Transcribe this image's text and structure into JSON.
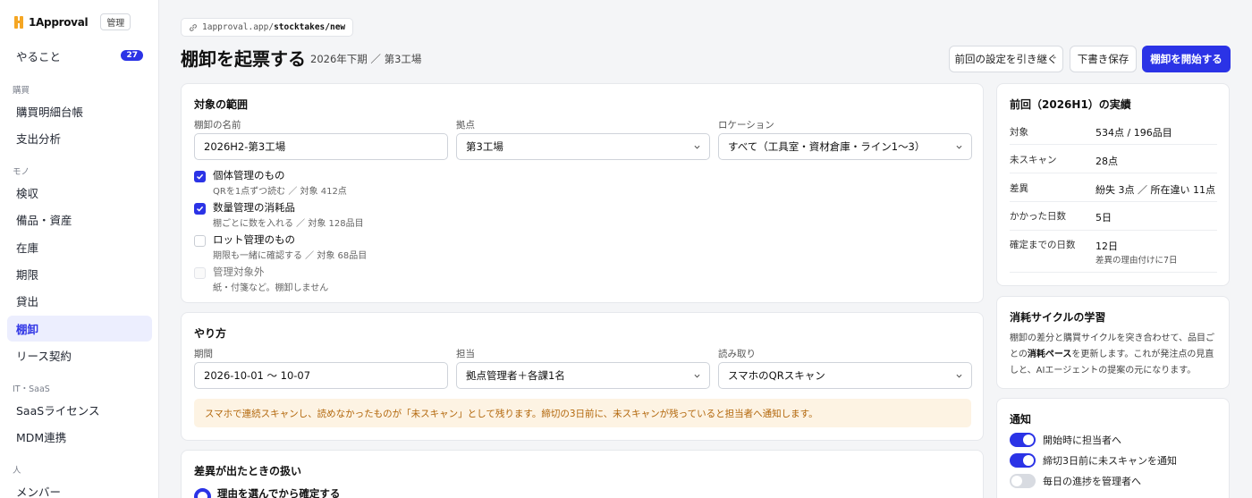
{
  "app": {
    "name": "1Approval",
    "admin_badge": "管理"
  },
  "sidebar": {
    "todo": {
      "label": "やること",
      "count": "27"
    },
    "sections": {
      "purchase": "購買",
      "mono": "モノ",
      "it_saas": "IT・SaaS",
      "people": "人"
    },
    "items": {
      "ledger": "購買明細台帳",
      "spend": "支出分析",
      "inspection": "検収",
      "assets": "備品・資産",
      "inventory": "在庫",
      "expiry": "期限",
      "lending": "貸出",
      "stocktake": "棚卸",
      "lease": "リース契約",
      "saas": "SaaSライセンス",
      "mdm": "MDM連携",
      "members": "メンバー"
    }
  },
  "url": {
    "prefix": "1approval.app/",
    "path": "stocktakes/new"
  },
  "header": {
    "title": "棚卸を起票する",
    "subtitle": "2026年下期 ／ 第3工場",
    "buttons": {
      "inherit": "前回の設定を引き継ぐ",
      "draft": "下書き保存",
      "start": "棚卸を開始する"
    }
  },
  "scope": {
    "title": "対象の範囲",
    "name_label": "棚卸の名前",
    "name_value": "2026H2-第3工場",
    "site_label": "拠点",
    "site_value": "第3工場",
    "location_label": "ロケーション",
    "location_value": "すべて（工具室・資材倉庫・ライン1〜3）",
    "checks": [
      {
        "label": "個体管理のもの",
        "sub": "QRを1点ずつ読む ／ 対象 412点",
        "state": "on"
      },
      {
        "label": "数量管理の消耗品",
        "sub": "棚ごとに数を入れる ／ 対象 128品目",
        "state": "on"
      },
      {
        "label": "ロット管理のもの",
        "sub": "期限も一緒に確認する ／ 対象 68品目",
        "state": "off"
      },
      {
        "label": "管理対象外",
        "sub": "紙・付箋など。棚卸しません",
        "state": "disabled"
      }
    ]
  },
  "method": {
    "title": "やり方",
    "period_label": "期間",
    "period_value": "2026-10-01 〜 10-07",
    "owner_label": "担当",
    "owner_value": "拠点管理者＋各課1名",
    "read_label": "読み取り",
    "read_value": "スマホのQRスキャン",
    "note": "スマホで連続スキャンし、読めなかったものが「未スキャン」として残ります。締切の3日前に、未スキャンが残っていると担当者へ通知します。"
  },
  "diff": {
    "title": "差異が出たときの扱い",
    "option": "理由を選んでから確定する"
  },
  "previous": {
    "title": "前回（2026H1）の実績",
    "rows": [
      {
        "key": "対象",
        "value": "534点 / 196品目"
      },
      {
        "key": "未スキャン",
        "value": "28点"
      },
      {
        "key": "差異",
        "value": "紛失 3点 ／ 所在違い 11点"
      },
      {
        "key": "かかった日数",
        "value": "5日"
      },
      {
        "key": "確定までの日数",
        "value": "12日",
        "sub": "差異の理由付けに7日"
      }
    ]
  },
  "cycle": {
    "title": "消耗サイクルの学習",
    "text_before": "棚卸の差分と購買サイクルを突き合わせて、品目ごとの",
    "text_bold": "消耗ペース",
    "text_after": "を更新します。これが発注点の見直しと、AIエージェントの提案の元になります。"
  },
  "notify": {
    "title": "通知",
    "toggles": [
      {
        "label": "開始時に担当者へ",
        "on": true
      },
      {
        "label": "締切3日前に未スキャンを通知",
        "on": true
      },
      {
        "label": "毎日の進捗を管理者へ",
        "on": false
      }
    ]
  },
  "colors": {
    "accent": "#2b33e6",
    "note_bg": "#fdf3e3",
    "note_text": "#b2660a"
  }
}
